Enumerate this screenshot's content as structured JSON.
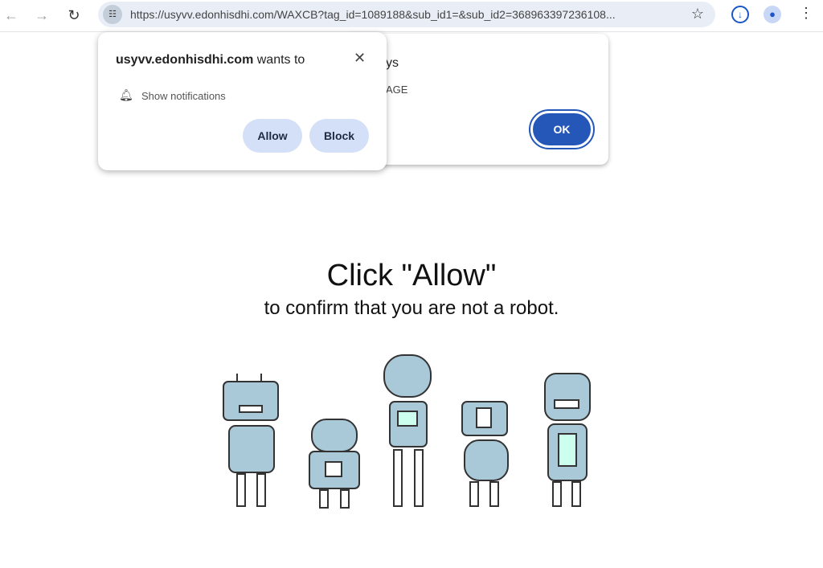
{
  "browser": {
    "url": "https://usyvv.edonhisdhi.com/WAXCB?tag_id=1089188&sub_id1=&sub_id2=368963397236108...",
    "icons": [
      "back-arrow-icon",
      "forward-arrow-icon",
      "reload-icon",
      "site-settings-icon",
      "bookmark-star-icon",
      "download-icon",
      "profile-icon",
      "more-menu-icon"
    ]
  },
  "alert": {
    "title_fragment": "ys",
    "message_fragment": "AGE",
    "ok_label": "OK"
  },
  "permission": {
    "site": "usyvv.edonhisdhi.com",
    "wants": " wants to",
    "item": "Show notifications",
    "allow_label": "Allow",
    "block_label": "Block"
  },
  "page": {
    "headline": "Click \"Allow\"",
    "subline": "to confirm that you are not a robot."
  },
  "colors": {
    "accent": "#2557b8",
    "button_bg": "#d3e0f7",
    "robot": "#a9c9d9"
  }
}
